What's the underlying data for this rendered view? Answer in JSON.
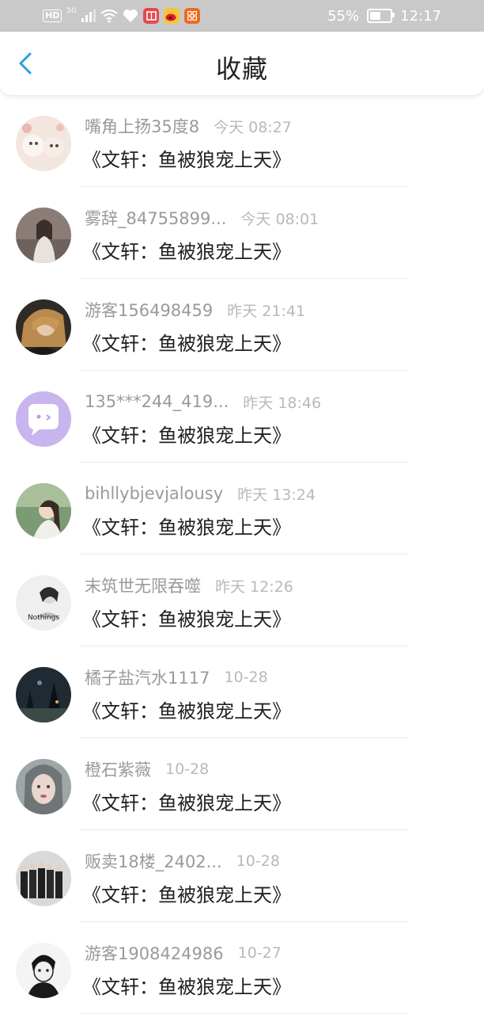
{
  "status_bar": {
    "hd": "HD",
    "signal": "5G",
    "battery_text": "55%",
    "battery_level": 0.55,
    "time": "12:17"
  },
  "header": {
    "title": "收藏"
  },
  "colors": {
    "accent": "#2a9fe0",
    "status_bar_bg": "#c9c9c9",
    "username": "#9a9a9a",
    "time": "#b9b9b9"
  },
  "items": [
    {
      "username": "嘴角上扬35度8",
      "time": "今天 08:27",
      "title": "《文轩：鱼被狼宠上天》"
    },
    {
      "username": "雾辞_84755899...",
      "time": "今天 08:01",
      "title": "《文轩：鱼被狼宠上天》"
    },
    {
      "username": "游客156498459",
      "time": "昨天 21:41",
      "title": "《文轩：鱼被狼宠上天》"
    },
    {
      "username": "135***244_419...",
      "time": "昨天 18:46",
      "title": "《文轩：鱼被狼宠上天》"
    },
    {
      "username": "bihllybjevjalousy",
      "time": "昨天 13:24",
      "title": "《文轩：鱼被狼宠上天》"
    },
    {
      "username": "末筑世无限吞噬",
      "time": "昨天 12:26",
      "title": "《文轩：鱼被狼宠上天》",
      "avatar_text": "Nothings"
    },
    {
      "username": "橘子盐汽水1117",
      "time": "10-28",
      "title": "《文轩：鱼被狼宠上天》"
    },
    {
      "username": "橙石紫薇",
      "time": "10-28",
      "title": "《文轩：鱼被狼宠上天》"
    },
    {
      "username": "贩卖18楼_2402...",
      "time": "10-28",
      "title": "《文轩：鱼被狼宠上天》"
    },
    {
      "username": "游客1908424986",
      "time": "10-27",
      "title": "《文轩：鱼被狼宠上天》"
    }
  ]
}
